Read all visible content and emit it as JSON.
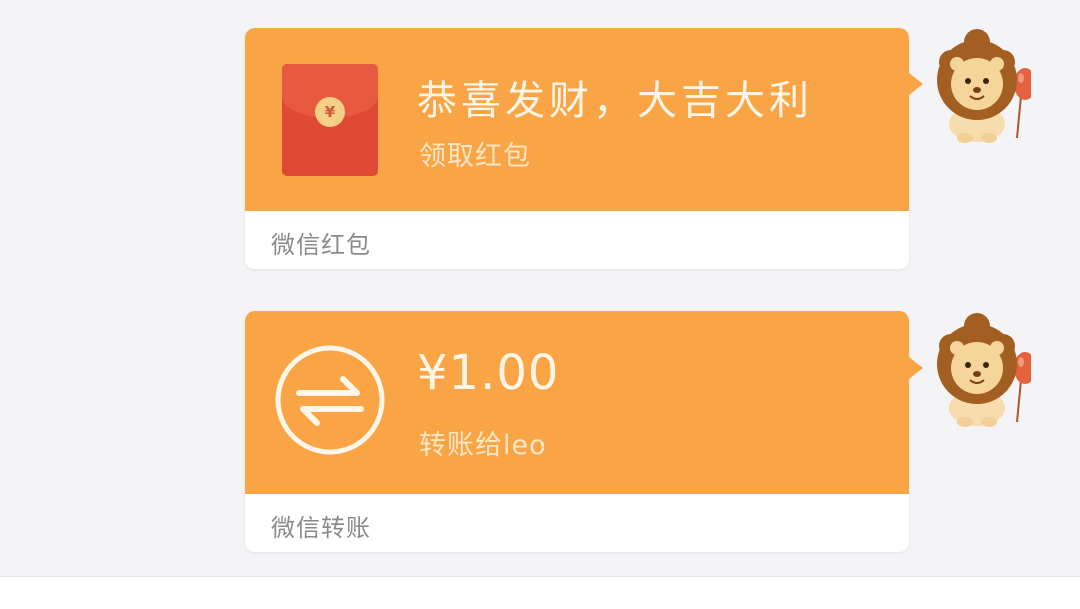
{
  "messages": [
    {
      "type": "red-packet",
      "title": "恭喜发财，大吉大利",
      "subtitle": "领取红包",
      "coin_glyph": "¥",
      "footer": "微信红包"
    },
    {
      "type": "transfer",
      "amount": "¥1.00",
      "subtitle": "转账给leo",
      "footer": "微信转账"
    }
  ],
  "colors": {
    "bubble": "#f9a445",
    "envelope": "#e04a34",
    "footer_text": "#8a8a8a",
    "background": "#f4f4f6"
  },
  "icons": {
    "red_packet": "red-envelope-icon",
    "transfer": "transfer-arrows-icon",
    "avatar": "lion-avatar"
  }
}
